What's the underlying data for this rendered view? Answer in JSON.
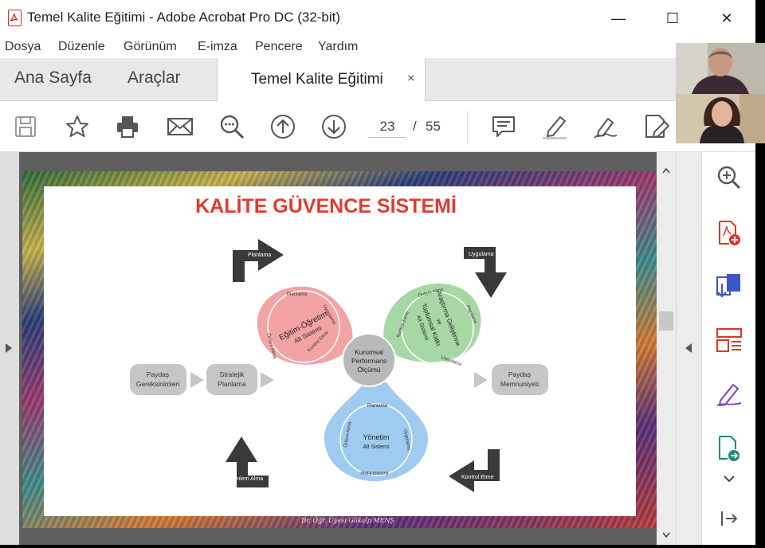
{
  "window": {
    "title": "Temel Kalite Eğitimi - Adobe Acrobat Pro DC (32-bit)",
    "controls": {
      "minimize": "—",
      "maximize": "☐",
      "close": "✕"
    }
  },
  "menu": [
    "Dosya",
    "Düzenle",
    "Görünüm",
    "E-imza",
    "Pencere",
    "Yardım"
  ],
  "tabs": {
    "home": "Ana Sayfa",
    "tools": "Araçlar",
    "document": "Temel Kalite Eğitimi",
    "close": "×"
  },
  "toolbar": {
    "icons": [
      "save-icon",
      "bookmark-star-icon",
      "print-icon",
      "email-icon",
      "zoom-out-icon",
      "previous-page-icon",
      "next-page-icon",
      "comment-icon",
      "highlight-icon",
      "sign-icon",
      "edit-pdf-icon"
    ],
    "current_page": "23",
    "separator": "/",
    "total_pages": "55"
  },
  "right_panel": {
    "icons": [
      "zoom-tool-icon",
      "create-pdf-icon",
      "export-pdf-icon",
      "organize-pages-icon",
      "fill-sign-icon",
      "send-for-review-icon",
      "expand-more-icon",
      "collapse-panel-icon"
    ],
    "colors": {
      "red": "#e0342b",
      "blue": "#3b56c9",
      "purple": "#7d3fc0",
      "teal": "#1e8a7a"
    }
  },
  "slide": {
    "title": "KALİTE GÜVENCE SİSTEMİ",
    "title_color": "#e23a2f",
    "arrows": {
      "planlama": "Planlama",
      "uygulama": "Uygulama",
      "kontrol": "Kontrol Etme",
      "onlem": "Önlem Alma"
    },
    "center": [
      "Kurumsal",
      "Performans",
      "Ölçümü"
    ],
    "left_box_1": [
      "Paydaş",
      "Gereksinimleri"
    ],
    "left_box_2": [
      "Stratejik",
      "Planlama"
    ],
    "right_box": [
      "Paydaş",
      "Memnuniyeti"
    ],
    "teaching": {
      "title": "Eğitim-Öğretim",
      "subtitle": "Alt Sistemi",
      "ring": [
        "Planlama",
        "Uygulama",
        "Kontrol Etme",
        "Önlem Alma"
      ],
      "color": "#f4a3a4"
    },
    "research": {
      "title_lines": [
        "Araştırma Geliştirme",
        "ve",
        "Toplumsal Katkı",
        "Alt Sistemi"
      ],
      "ring": [
        "Önlem Alma",
        "Planlama",
        "Uygulama",
        "Kontrol Etme"
      ],
      "color": "#a6d7a5"
    },
    "management": {
      "title": "Yönetim",
      "subtitle": "Alt Sistemi",
      "ring": [
        "Planlama",
        "Uygulama",
        "Kontrol Etme",
        "Önlem Alma"
      ],
      "color": "#9fcbf0"
    },
    "signature": "Dr. Öğr. Üyesi Gökalp MENŞ"
  }
}
